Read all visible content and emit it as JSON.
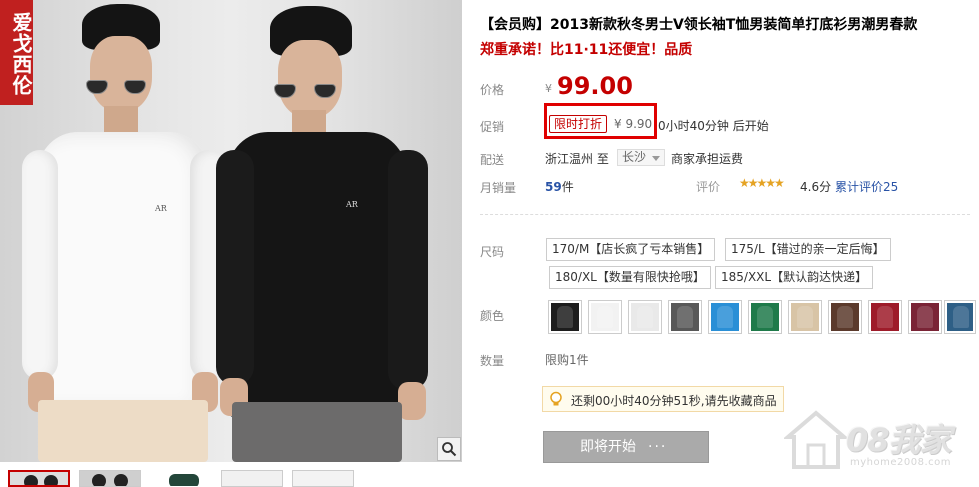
{
  "gallery": {
    "brand_badge": "爱戈西伦",
    "shirt_logo": "AR",
    "zoom_icon": "magnifier-icon",
    "thumbnail_count": 5
  },
  "product": {
    "title": "【会员购】2013新款秋冬男士V领长袖T恤男装简单打底衫男潮男春款",
    "subtitle": "郑重承诺！比11·11还便宜！品质"
  },
  "price": {
    "label": "价格",
    "currency": "¥",
    "value": "99.00"
  },
  "promotion": {
    "label": "促销",
    "tag": "限时打折",
    "price": "¥ 9.90",
    "time": "0小时40分钟 后开始",
    "highlight_color": "#e00000"
  },
  "shipping": {
    "label": "配送",
    "from": "浙江温州 至",
    "to": "长沙",
    "note": "商家承担运费"
  },
  "sales": {
    "label": "月销量",
    "count": "59",
    "unit": "件",
    "rating_label": "评价",
    "stars": "★★★★★",
    "score": "4.6分",
    "review_link": "累计评价25"
  },
  "size": {
    "label": "尺码",
    "options": [
      "170/M【店长疯了亏本销售】",
      "175/L【错过的亲一定后悔】",
      "180/XL【数量有限快抢哦】",
      "185/XXL【默认韵达快递】"
    ]
  },
  "color": {
    "label": "颜色",
    "swatches": [
      "#1d1d1d",
      "#f2f2f2",
      "#e9e9e9",
      "#585858",
      "#2a8fd6",
      "#1f7a4a",
      "#d8c4a6",
      "#5b3a2c",
      "#9e1c2a",
      "#7a2436",
      "#2e5f86"
    ]
  },
  "quantity": {
    "label": "数量",
    "note": "限购1件"
  },
  "tip": {
    "icon": "lightbulb-icon",
    "text": "还剩00小时40分钟51秒,请先收藏商品"
  },
  "buy_button": {
    "label": "即将开始",
    "dots": "···"
  },
  "watermark": {
    "text": "08我家",
    "url": "myhome2008.com"
  },
  "colors": {
    "accent_red": "#c40000",
    "link_blue": "#2953a6"
  }
}
